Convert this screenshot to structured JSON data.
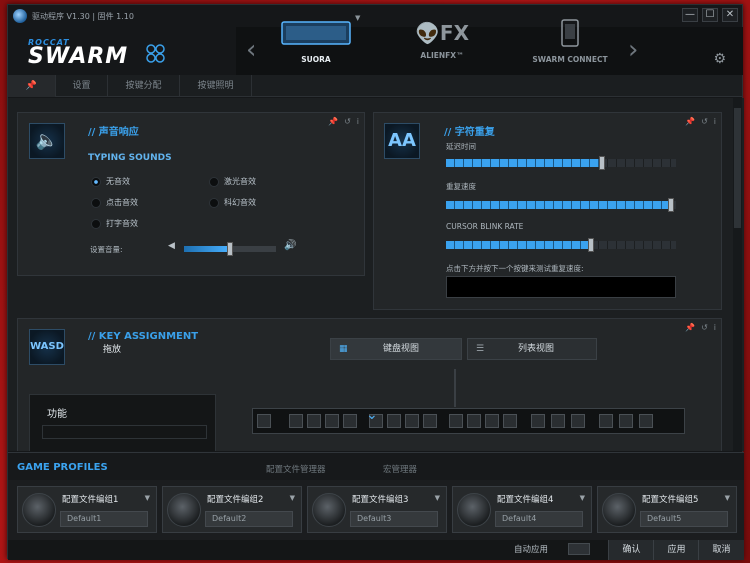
{
  "window": {
    "title": "驱动程序 V1.30 | 固件 1.10",
    "controls": {
      "minimize": "—",
      "maximize": "☐",
      "close": "✕"
    }
  },
  "brand": {
    "small": "ROCCAT",
    "big": "SWARM"
  },
  "devices": [
    {
      "label": "SUORA",
      "active": true
    },
    {
      "label": "ALIENFX™",
      "active": false
    },
    {
      "label": "SWARM CONNECT",
      "active": false
    }
  ],
  "tabs": [
    "设置",
    "按键分配",
    "按键照明"
  ],
  "sound_panel": {
    "title": "// 声音响应",
    "heading": "TYPING SOUNDS",
    "options": [
      {
        "label": "无音效",
        "selected": true
      },
      {
        "label": "激光音效",
        "selected": false
      },
      {
        "label": "点击音效",
        "selected": false
      },
      {
        "label": "科幻音效",
        "selected": false
      },
      {
        "label": "打字音效",
        "selected": false
      }
    ],
    "volume_label": "设置音量:",
    "volume_level": 0.5
  },
  "repeat_panel": {
    "title": "// 字符重复",
    "delay_label": "延迟时间",
    "delay_level": 0.68,
    "rate_label": "重复速度",
    "rate_level": 0.98,
    "blink_label": "CURSOR BLINK RATE",
    "blink_level": 0.63,
    "test_label": "点击下方并按下一个按键来测试重复速度:",
    "test_value": ""
  },
  "key_panel": {
    "title": "// KEY ASSIGNMENT",
    "subtitle": "拖放",
    "keyboard_view": "键盘视图",
    "list_view": "列表视图",
    "function_label": "功能"
  },
  "game_profiles": {
    "title": "GAME PROFILES",
    "tabs": [
      "配置文件管理器",
      "宏管理器"
    ],
    "profiles": [
      {
        "name": "配置文件编组1",
        "value": "Default1"
      },
      {
        "name": "配置文件编组2",
        "value": "Default2"
      },
      {
        "name": "配置文件编组3",
        "value": "Default3"
      },
      {
        "name": "配置文件编组4",
        "value": "Default4"
      },
      {
        "name": "配置文件编组5",
        "value": "Default5"
      }
    ]
  },
  "footer": {
    "auto_apply": "自动应用",
    "ok": "确认",
    "apply": "应用",
    "cancel": "取消"
  }
}
